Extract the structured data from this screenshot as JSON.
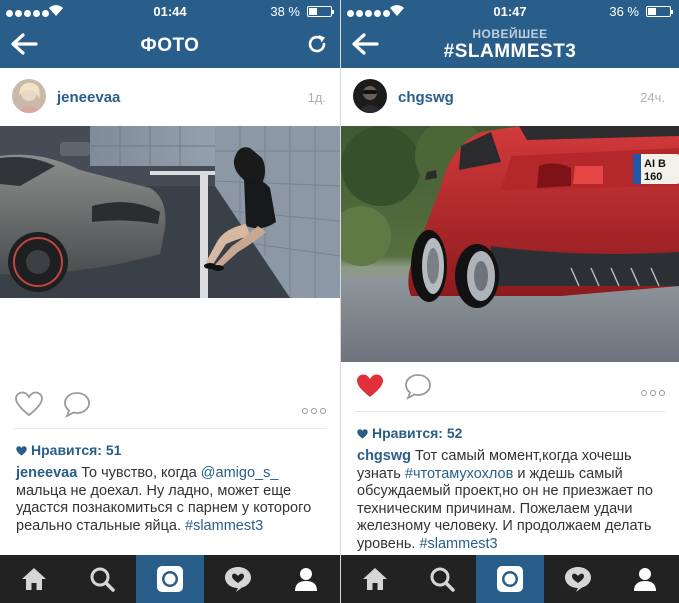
{
  "left": {
    "status": {
      "time": "01:44",
      "battery": "38 %",
      "battery_level": 0.38
    },
    "nav": {
      "title": "ФОТО"
    },
    "post": {
      "username": "jeneevaa",
      "age": "1д.",
      "likes_label": "Нравится: 51",
      "caption": {
        "user": "jeneevaa",
        "text1": " То чувство, когда ",
        "mention": "@amigo_s_",
        "text2": " мальца не доехал. Ну ладно, может еще удастся познакомиться с парнем у которого реально стальные яйца. ",
        "tag": "#slammest3"
      }
    }
  },
  "right": {
    "status": {
      "time": "01:47",
      "battery": "36 %",
      "battery_level": 0.36
    },
    "nav": {
      "kicker": "НОВЕЙШЕЕ",
      "title": "#SLAMMEST3"
    },
    "post": {
      "username": "chgswg",
      "age": "24ч.",
      "likes_label": "Нравится: 52",
      "plate": {
        "top": "AI B",
        "bottom": "160"
      },
      "caption": {
        "user": "chgswg",
        "text1": " Тот самый момент,когда хочешь узнать ",
        "tag1": "#чтотамухохлов",
        "text2": " и ждешь самый обсуждаемый проект,но он не приезжает по техническим причинам. Пожелаем удачи железному человеку. И продолжаем делать уровень. ",
        "tag2": "#slammest3"
      }
    }
  },
  "tabs": [
    "home-icon",
    "search-icon",
    "camera-icon",
    "activity-icon",
    "profile-icon"
  ],
  "colors": {
    "brand": "#2a5e8a",
    "tabbar": "#222222",
    "liked": "#e0313b"
  }
}
